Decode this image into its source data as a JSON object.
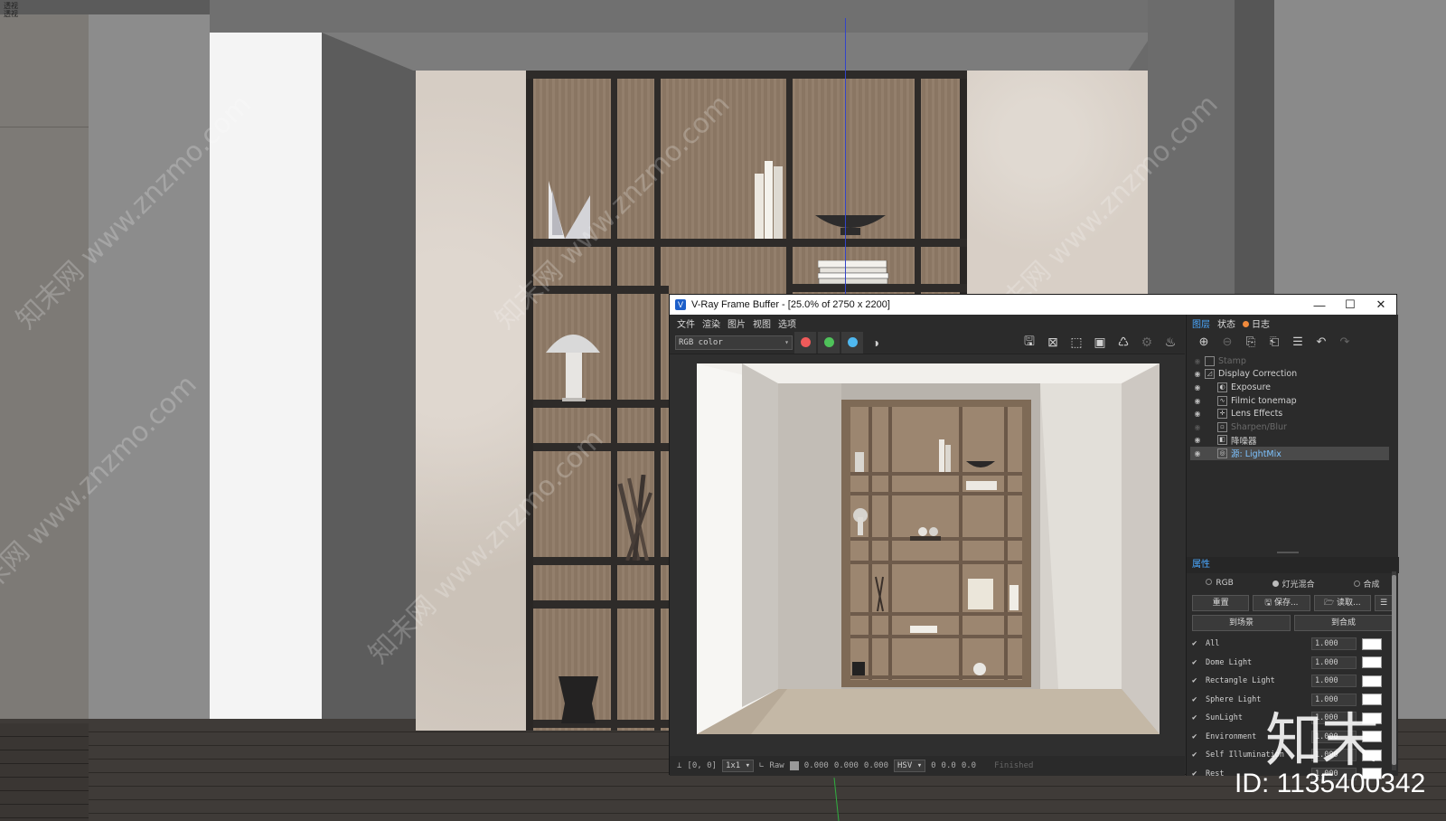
{
  "corner_label": [
    "透视",
    "透视"
  ],
  "window": {
    "title": "V-Ray Frame Buffer - [25.0% of 2750 x 2200]",
    "buttons": {
      "minimize": "—",
      "maximize": "☐",
      "close": "✕"
    }
  },
  "menu": [
    "文件",
    "渲染",
    "图片",
    "视图",
    "选项"
  ],
  "toolbar": {
    "channel": "RGB color",
    "channel_colors": {
      "red": "#f05a5a",
      "green": "#4fc25a",
      "blue": "#4fb8f0"
    }
  },
  "statusbar": {
    "coords": "[0, 0]",
    "zoom": "1x1",
    "raw_label": "Raw",
    "rgb": [
      "0.000",
      "0.000",
      "0.000"
    ],
    "color_mode": "HSV",
    "hsv": [
      "0",
      "0.0",
      "0.0"
    ],
    "status": "Finished"
  },
  "right_panel": {
    "tabs": [
      "图层",
      "状态",
      "日志"
    ],
    "layers": [
      {
        "name": "Stamp",
        "enabled": false,
        "indent": 1
      },
      {
        "name": "Display Correction",
        "enabled": true,
        "indent": 1
      },
      {
        "name": "Exposure",
        "enabled": true,
        "indent": 2
      },
      {
        "name": "Filmic tonemap",
        "enabled": true,
        "indent": 2
      },
      {
        "name": "Lens Effects",
        "enabled": true,
        "indent": 2
      },
      {
        "name": "Sharpen/Blur",
        "enabled": false,
        "indent": 2
      },
      {
        "name": "降噪器",
        "enabled": true,
        "indent": 2
      },
      {
        "name": "源: LightMix",
        "enabled": true,
        "indent": 2,
        "selected": true
      }
    ],
    "properties_title": "属性",
    "modes": [
      "RGB",
      "灯光混合",
      "合成"
    ],
    "selected_mode": "灯光混合",
    "buttons_row1": [
      "重置",
      "保存...",
      "读取..."
    ],
    "buttons_row2": [
      "到场景",
      "到合成"
    ],
    "lights": [
      {
        "name": "All",
        "value": "1.000"
      },
      {
        "name": "Dome Light",
        "value": "1.000"
      },
      {
        "name": "Rectangle Light",
        "value": "1.000"
      },
      {
        "name": "Sphere Light",
        "value": "1.000"
      },
      {
        "name": "SunLight",
        "value": "1.000"
      },
      {
        "name": "Environment",
        "value": "1.000"
      },
      {
        "name": "Self Illumination",
        "value": "1.000"
      },
      {
        "name": "Rest",
        "value": "1.000"
      }
    ]
  },
  "watermark_text": "知末网 www.znzmo.com",
  "logo_text": "知末",
  "asset_id": "ID: 1135400342"
}
